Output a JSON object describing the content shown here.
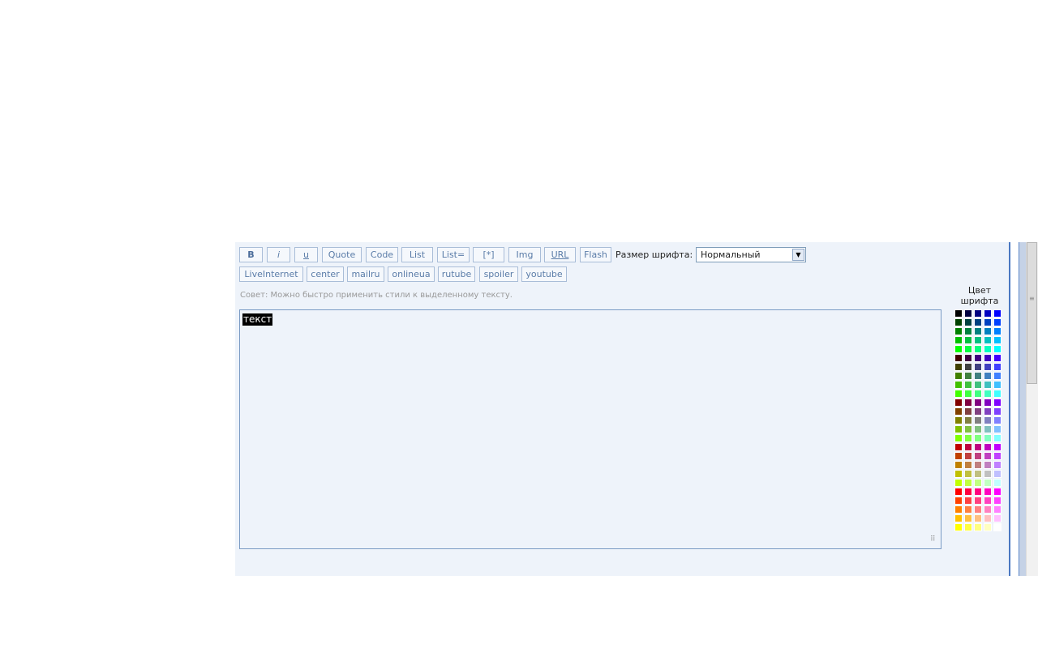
{
  "toolbar": {
    "row1": [
      {
        "id": "bold",
        "label": "B"
      },
      {
        "id": "italic",
        "label": "i"
      },
      {
        "id": "underline",
        "label": "u"
      },
      {
        "id": "quote",
        "label": "Quote"
      },
      {
        "id": "code",
        "label": "Code"
      },
      {
        "id": "list",
        "label": "List"
      },
      {
        "id": "list-eq",
        "label": "List="
      },
      {
        "id": "list-item",
        "label": "[*]"
      },
      {
        "id": "img",
        "label": "Img"
      },
      {
        "id": "url",
        "label": "URL"
      },
      {
        "id": "flash",
        "label": "Flash"
      }
    ],
    "font_size_label": "Размер шрифта:",
    "font_size_value": "Нормальный",
    "row2": [
      {
        "id": "liveinternet",
        "label": "LiveInternet"
      },
      {
        "id": "center",
        "label": "center"
      },
      {
        "id": "mailru",
        "label": "mailru"
      },
      {
        "id": "onlineua",
        "label": "onlineua"
      },
      {
        "id": "rutube",
        "label": "rutube"
      },
      {
        "id": "spoiler",
        "label": "spoiler"
      },
      {
        "id": "youtube",
        "label": "youtube"
      }
    ]
  },
  "hint": "Совет: Можно быстро применить стили к выделенному тексту.",
  "editor": {
    "selected_text": "текст"
  },
  "color_panel": {
    "title_line1": "Цвет",
    "title_line2": "шрифта"
  },
  "colors": {
    "panel_bg": "#eef3fa",
    "border": "#7a9bc4",
    "button_text": "#5a7ca8"
  }
}
